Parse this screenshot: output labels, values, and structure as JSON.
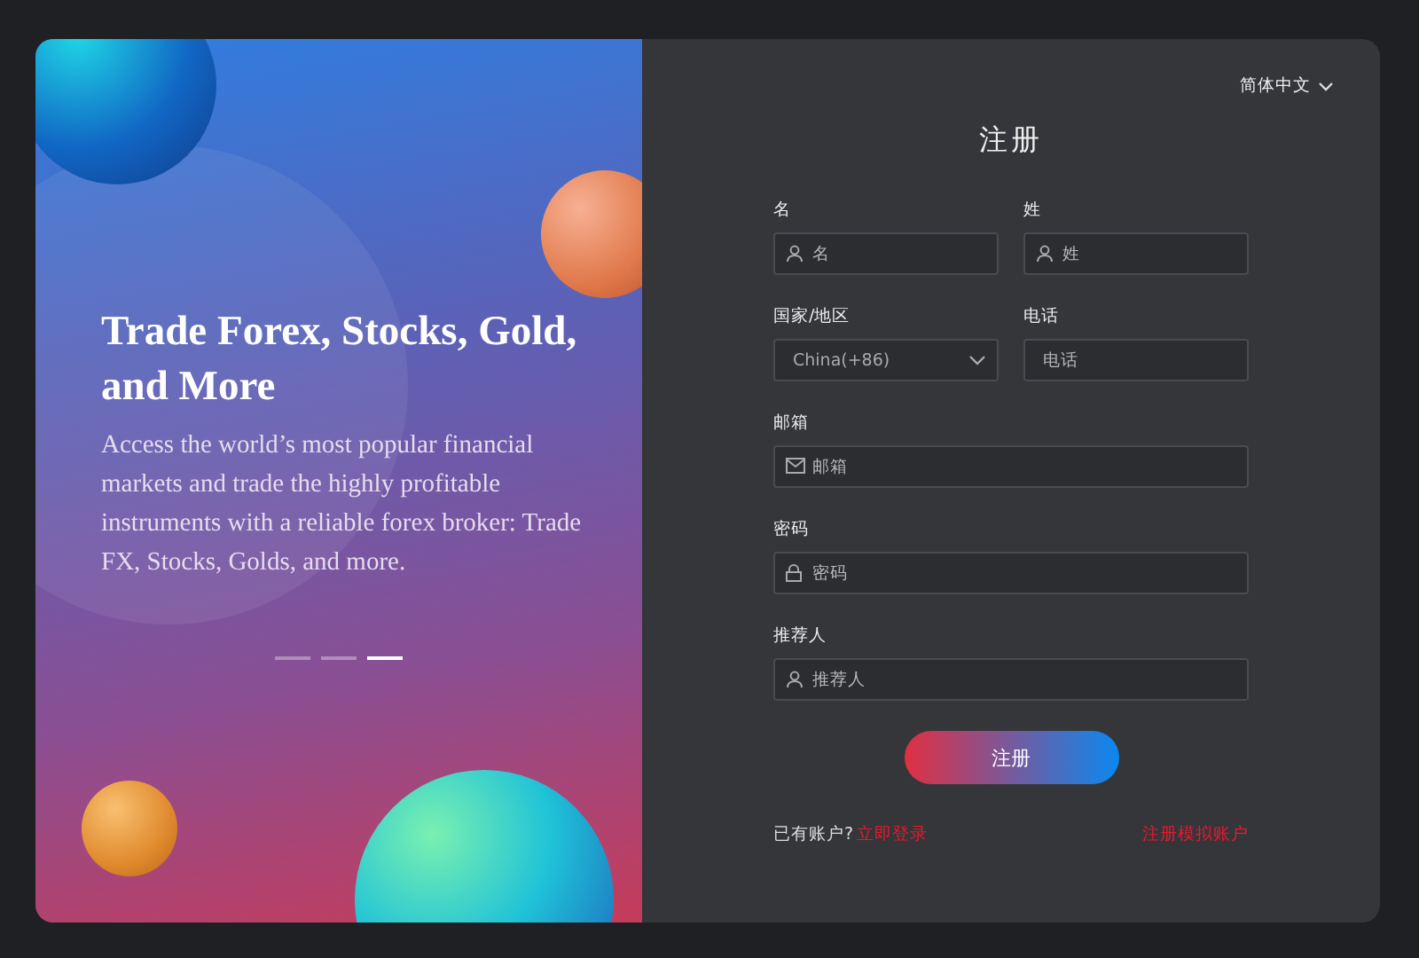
{
  "hero": {
    "title": "Trade Forex, Stocks, Gold, and More",
    "text": "Access the world’s most popular financial markets and trade the highly profitable instruments with a reliable forex broker: Trade FX, Stocks, Golds, and more.",
    "slides": [
      {
        "selected": false
      },
      {
        "selected": false
      },
      {
        "selected": true
      }
    ]
  },
  "language": "简体中文",
  "form": {
    "title": "注册",
    "rows": [
      [
        {
          "label": "名",
          "kind": "user",
          "placeholder": "名"
        },
        {
          "label": "姓",
          "kind": "user",
          "placeholder": "姓"
        }
      ],
      [
        {
          "label": "国家/地区",
          "kind": "select",
          "value": "China(+86)"
        },
        {
          "label": "电话",
          "kind": "plain",
          "placeholder": "电话"
        }
      ],
      [
        {
          "label": "邮箱",
          "kind": "mail",
          "placeholder": "邮箱"
        }
      ],
      [
        {
          "label": "密码",
          "kind": "lock",
          "placeholder": "密码"
        }
      ],
      [
        {
          "label": "推荐人",
          "kind": "user",
          "placeholder": "推荐人"
        }
      ]
    ],
    "submit": "注册",
    "have_account": "已有账户?",
    "login_link": "立即登录",
    "demo_link": "注册模拟账户"
  }
}
